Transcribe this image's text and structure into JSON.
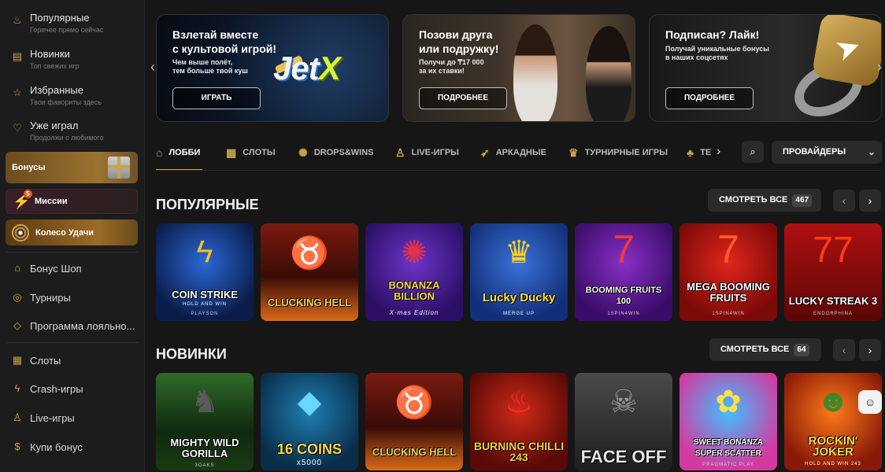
{
  "sidebar": {
    "top_items": [
      {
        "label": "Популярные",
        "sub": "Горячее прямо сейчас",
        "icon": "flame-icon"
      },
      {
        "label": "Новинки",
        "sub": "Топ свежих игр",
        "icon": "new-icon"
      },
      {
        "label": "Избранные",
        "sub": "Твои фавориты здесь",
        "icon": "star-icon"
      },
      {
        "label": "Уже играл",
        "sub": "Продолжи с любимого",
        "icon": "heart-icon"
      }
    ],
    "promos": {
      "bonus": "Бонусы",
      "missions": "Миссии",
      "missions_badge": "5",
      "wheel": "Колесо Удачи"
    },
    "mid_items": [
      {
        "label": "Бонус Шоп",
        "icon": "gift-icon"
      },
      {
        "label": "Турниры",
        "icon": "cup-icon"
      },
      {
        "label": "Программа лояльно...",
        "icon": "diamond-icon"
      }
    ],
    "bottom_items": [
      {
        "label": "Слоты",
        "icon": "slots-icon"
      },
      {
        "label": "Crash-игры",
        "icon": "crash-icon"
      },
      {
        "label": "Live-игры",
        "icon": "live-icon"
      },
      {
        "label": "Купи бонус",
        "icon": "buy-bonus-icon"
      }
    ]
  },
  "banners": [
    {
      "title": "Взлетай вместе\nс культовой игрой!",
      "sub": "Чем выше полёт,\nтем больше твой куш",
      "button": "ИГРАТЬ",
      "logo": "JetX"
    },
    {
      "title": "Позови друга\nили подружку!",
      "sub": "Получи до ₸17 000\nза их ставки!",
      "button": "ПОДРОБНЕЕ"
    },
    {
      "title": "Подписан? Лайк!",
      "sub": "Получай уникальные бонусы\nв наших соцсетях",
      "button": "ПОДРОБНЕЕ"
    }
  ],
  "tabs": [
    {
      "label": "ЛОББИ",
      "icon": "home-icon",
      "active": true
    },
    {
      "label": "СЛОТЫ",
      "icon": "slots-icon"
    },
    {
      "label": "DROPS&WINS",
      "icon": "drops-icon"
    },
    {
      "label": "LIVE-ИГРЫ",
      "icon": "live-icon"
    },
    {
      "label": "АРКАДНЫЕ",
      "icon": "rocket-icon"
    },
    {
      "label": "ТУРНИРНЫЕ ИГРЫ",
      "icon": "cup-icon"
    },
    {
      "label": "ТЕ",
      "icon": "cherry-icon"
    }
  ],
  "providers_label": "ПРОВАЙДЕРЫ",
  "sections": [
    {
      "title": "ПОПУЛЯРНЫЕ",
      "see_all": "СМОТРЕТЬ ВСЕ",
      "count": "467",
      "games": [
        {
          "name": "COIN STRIKE",
          "tag": "HOLD AND WIN",
          "provider": "PLAYSON"
        },
        {
          "name": "CLUCKING HELL",
          "provider": ""
        },
        {
          "name": "BONANZA BILLION",
          "tag": "X-mas Edition",
          "provider": ""
        },
        {
          "name": "Lucky Ducky",
          "tag": "MERGE UP",
          "provider": ""
        },
        {
          "name": "BOOMING FRUITS 100",
          "provider": "1SPIN4WIN"
        },
        {
          "name": "MEGA BOOMING FRUITS",
          "provider": "1SPIN4WIN"
        },
        {
          "name": "LUCKY STREAK 3",
          "provider": "ENDORPHINA"
        }
      ]
    },
    {
      "title": "НОВИНКИ",
      "see_all": "СМОТРЕТЬ ВСЕ",
      "count": "64",
      "games": [
        {
          "name": "MIGHTY WILD GORILLA",
          "provider": "3OAKS"
        },
        {
          "name": "16 COINS",
          "tag": "x5000",
          "provider": ""
        },
        {
          "name": "CLUCKING HELL",
          "provider": ""
        },
        {
          "name": "BURNING CHILLI 243",
          "provider": ""
        },
        {
          "name": "FACE OFF",
          "provider": ""
        },
        {
          "name": "SWEET BONANZA SUPER SCATTER",
          "provider": "PRAGMATIC PLAY"
        },
        {
          "name": "ROCKIN' JOKER",
          "tag": "HOLD AND WIN 243",
          "provider": ""
        }
      ]
    }
  ],
  "colors": {
    "accent": "#c9a44a",
    "background": "#161616",
    "sidebar": "#1c1c1c"
  }
}
